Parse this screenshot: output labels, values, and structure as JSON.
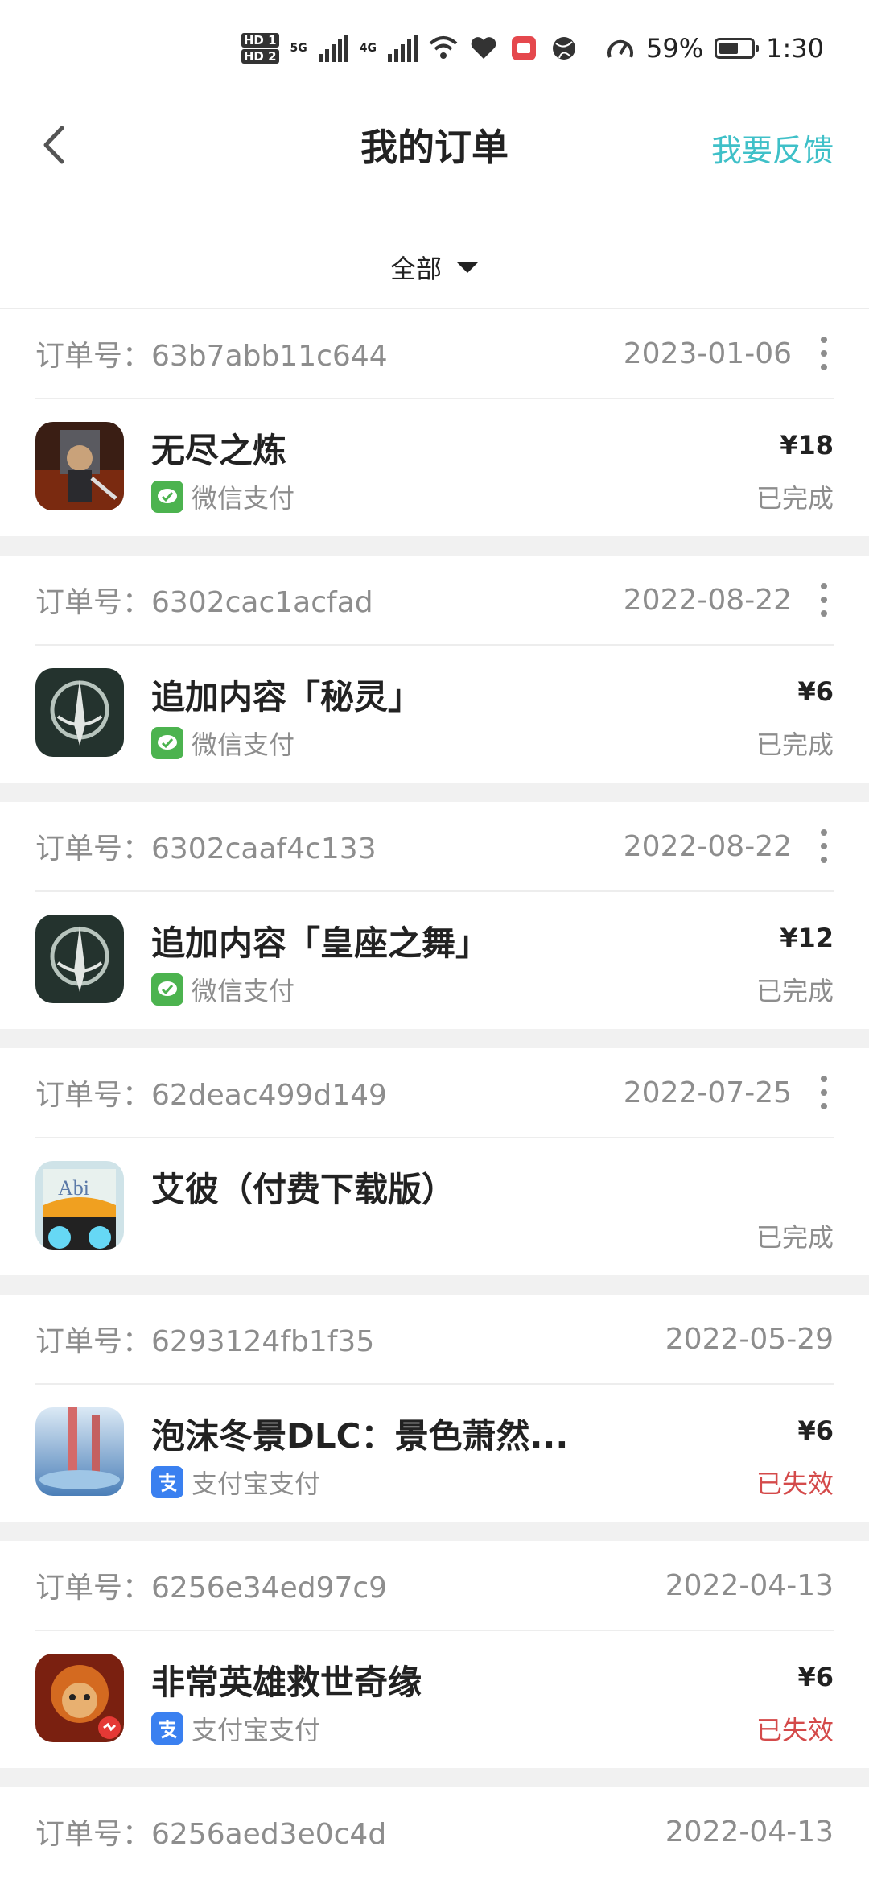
{
  "status_bar": {
    "hd1": "HD 1",
    "hd2": "HD 2",
    "net1": "5G",
    "net2": "4G",
    "battery_percent": "59%",
    "battery_level": 0.59,
    "time": "1:30"
  },
  "header": {
    "title": "我的订单",
    "feedback_label": "我要反馈"
  },
  "filter": {
    "label": "全部"
  },
  "colors": {
    "accent": "#3fc0c8",
    "invalid": "#d44a4a",
    "wechat": "#4cb34f",
    "alipay": "#3a80f0"
  },
  "orders": [
    {
      "order_no": "订单号：63b7abb11c644",
      "date": "2023-01-06",
      "name": "无尽之炼",
      "payment": "微信支付",
      "payment_icon": "wechat-pay-icon",
      "price": "¥18",
      "status": "已完成"
    },
    {
      "order_no": "订单号：6302cac1acfad",
      "date": "2022-08-22",
      "name": "追加内容「秘灵」",
      "payment": "微信支付",
      "payment_icon": "wechat-pay-icon",
      "price": "¥6",
      "status": "已完成"
    },
    {
      "order_no": "订单号：6302caaf4c133",
      "date": "2022-08-22",
      "name": "追加内容「皇座之舞」",
      "payment": "微信支付",
      "payment_icon": "wechat-pay-icon",
      "price": "¥12",
      "status": "已完成"
    },
    {
      "order_no": "订单号：62deac499d149",
      "date": "2022-07-25",
      "name": "艾彼（付费下载版）",
      "status": "已完成"
    },
    {
      "order_no": "订单号：6293124fb1f35",
      "date": "2022-05-29",
      "name": "泡沫冬景DLC：景色萧然...",
      "payment": "支付宝支付",
      "payment_icon": "alipay-icon",
      "price": "¥6",
      "status": "已失效"
    },
    {
      "order_no": "订单号：6256e34ed97c9",
      "date": "2022-04-13",
      "name": "非常英雄救世奇缘",
      "payment": "支付宝支付",
      "payment_icon": "alipay-icon",
      "price": "¥6",
      "status": "已失效"
    },
    {
      "order_no": "订单号：6256aed3e0c4d",
      "date": "2022-04-13"
    }
  ]
}
